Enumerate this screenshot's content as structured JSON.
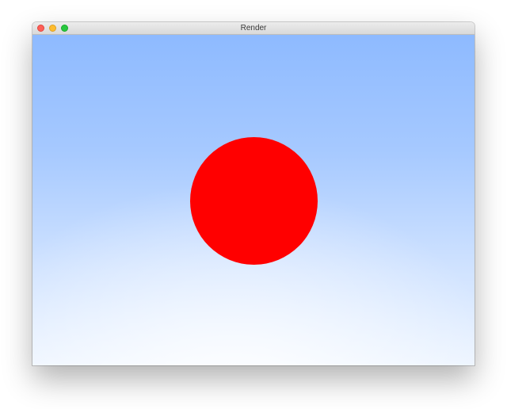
{
  "window": {
    "title": "Render"
  },
  "scene": {
    "sphere_color": "#ff0000",
    "sky_top_color": "#8ebaff",
    "sky_bottom_color": "#ecf4ff"
  }
}
